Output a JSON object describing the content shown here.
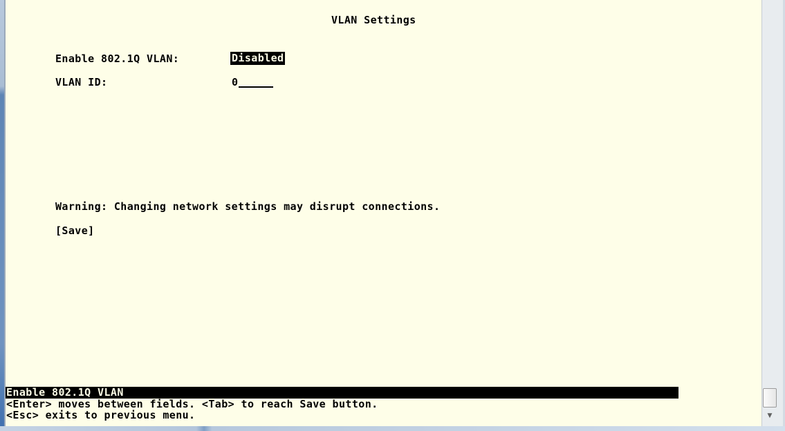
{
  "screen": {
    "title": "VLAN Settings"
  },
  "fields": {
    "vlan_enable": {
      "label": "Enable 802.1Q VLAN:",
      "value": "Disabled"
    },
    "vlan_id": {
      "label": "VLAN ID:",
      "value": "0"
    }
  },
  "warning": "Warning: Changing network settings may disrupt connections.",
  "save_button": "[Save]",
  "status": {
    "current_field": "Enable 802.1Q VLAN",
    "help_line_1": "<Enter> moves between fields. <Tab> to reach Save button.",
    "help_line_2": "<Esc> exits to previous menu."
  },
  "scrollbar": {
    "down_icon": "▼"
  },
  "colors": {
    "terminal_background": "#fefee8",
    "terminal_text": "#000000",
    "highlight_background": "#000000",
    "highlight_text": "#fefee8"
  }
}
